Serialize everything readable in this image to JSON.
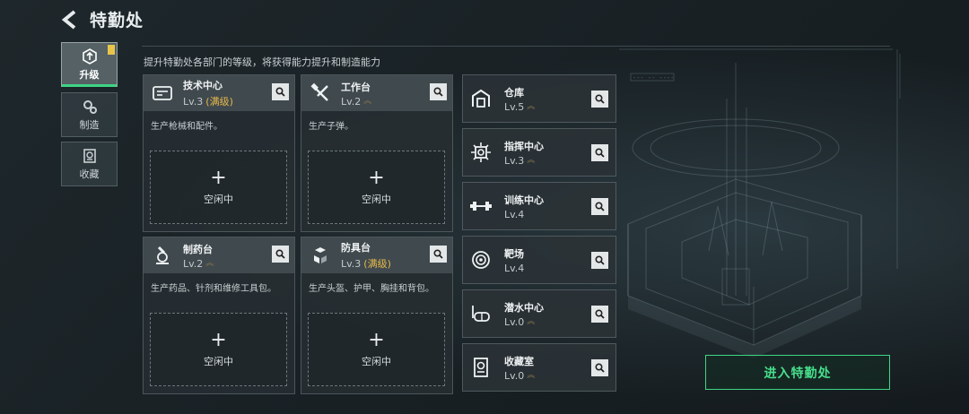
{
  "header": {
    "title": "特勤处"
  },
  "subtitle": "提升特勤处各部门的等级，将获得能力提升和制造能力",
  "sidebar": {
    "items": [
      {
        "label": "升级",
        "icon": "upgrade-icon",
        "active": true
      },
      {
        "label": "制造",
        "icon": "gears-icon",
        "active": false
      },
      {
        "label": "收藏",
        "icon": "collection-icon",
        "active": false
      }
    ]
  },
  "big_cards": [
    {
      "name": "技术中心",
      "level": "Lv.3",
      "max": "(满级)",
      "desc": "生产枪械和配件。",
      "slot": "空闲中",
      "icon": "tech-center-icon"
    },
    {
      "name": "工作台",
      "level": "Lv.2",
      "max": "",
      "desc": "生产子弹。",
      "slot": "空闲中",
      "icon": "workbench-icon"
    },
    {
      "name": "制药台",
      "level": "Lv.2",
      "max": "",
      "desc": "生产药品、针剂和维修工具包。",
      "slot": "空闲中",
      "icon": "pharmacy-icon"
    },
    {
      "name": "防具台",
      "level": "Lv.3",
      "max": "(满级)",
      "desc": "生产头盔、护甲、胸挂和背包。",
      "slot": "空闲中",
      "icon": "armor-bench-icon"
    }
  ],
  "small_cards": [
    {
      "name": "仓库",
      "level": "Lv.5",
      "icon": "warehouse-icon"
    },
    {
      "name": "指挥中心",
      "level": "Lv.3",
      "icon": "command-center-icon"
    },
    {
      "name": "训练中心",
      "level": "Lv.4",
      "icon": "training-center-icon"
    },
    {
      "name": "靶场",
      "level": "Lv.4",
      "icon": "shooting-range-icon"
    },
    {
      "name": "潜水中心",
      "level": "Lv.0",
      "icon": "diving-center-icon"
    },
    {
      "name": "收藏室",
      "level": "Lv.0",
      "icon": "collection-room-icon"
    }
  ],
  "enter_button": "进入特勤处",
  "hud": {
    "readout": "--- -- ----"
  },
  "colors": {
    "accent": "#3ed585",
    "max_level": "#e6b84a",
    "badge": "#e8c54a"
  }
}
